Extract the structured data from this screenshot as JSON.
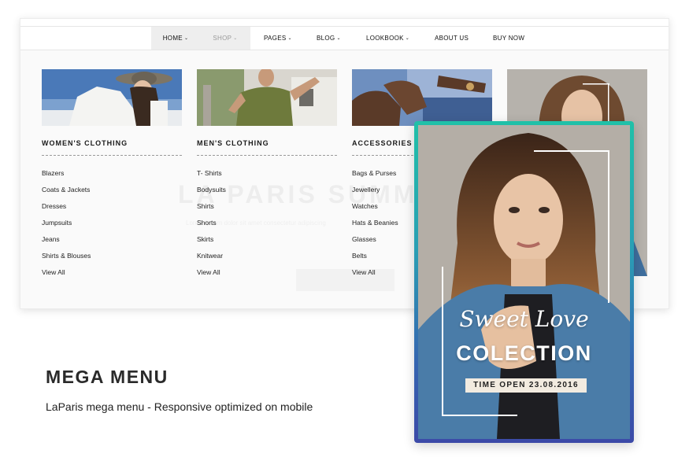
{
  "nav": {
    "items": [
      {
        "label": "HOME",
        "has_dropdown": true
      },
      {
        "label": "SHOP",
        "has_dropdown": true
      },
      {
        "label": "PAGES",
        "has_dropdown": true
      },
      {
        "label": "BLOG",
        "has_dropdown": true
      },
      {
        "label": "LOOKBOOK",
        "has_dropdown": true
      },
      {
        "label": "ABOUT US",
        "has_dropdown": false
      },
      {
        "label": "BUY NOW",
        "has_dropdown": false
      }
    ],
    "chevron": "⌄"
  },
  "mega_menu": {
    "columns": [
      {
        "title": "WOMEN'S CLOTHING",
        "image": "woman-hat-photo",
        "links": [
          "Blazers",
          "Coats & Jackets",
          "Dresses",
          "Jumpsuits",
          "Jeans",
          "Shirts & Blouses",
          "View All"
        ]
      },
      {
        "title": "MEN'S CLOTHING",
        "image": "man-tshirt-photo",
        "links": [
          "T- Shirts",
          "Bodysuits",
          "Shirts",
          "Shorts",
          "Skirts",
          "Knitwear",
          "View All"
        ]
      },
      {
        "title": "ACCESSORIES",
        "image": "boots-jeans-photo",
        "links": [
          "Bags & Purses",
          "Jewellery",
          "Watches",
          "Hats & Beanies",
          "Glasses",
          "Belts",
          "View All"
        ]
      }
    ]
  },
  "promo": {
    "title": "MEGA MENU",
    "subtitle": "LaParis mega menu - Responsive optimized on mobile"
  },
  "banner": {
    "script_text": "Sweet Love",
    "title": "COLECTION",
    "date_label": "TIME OPEN 23.08.2016",
    "border_colors": [
      "#20c0a8",
      "#3c4aa8"
    ]
  }
}
